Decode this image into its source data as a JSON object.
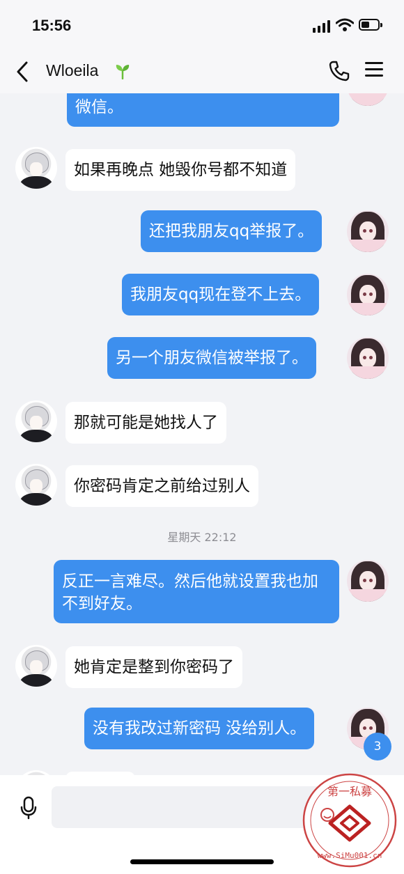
{
  "status_bar": {
    "time": "15:56"
  },
  "header": {
    "contact_name": "Wloeila"
  },
  "messages": [
    {
      "side": "out",
      "text": "微信。"
    },
    {
      "side": "in",
      "text": "如果再晚点 她毁你号都不知道"
    },
    {
      "side": "out",
      "text": "还把我朋友qq举报了。"
    },
    {
      "side": "out",
      "text": "我朋友qq现在登不上去。"
    },
    {
      "side": "out",
      "text": "另一个朋友微信被举报了。"
    },
    {
      "side": "in",
      "text": "那就可能是她找人了"
    },
    {
      "side": "in",
      "text": "你密码肯定之前给过别人"
    },
    {
      "side": "out",
      "text": "反正一言难尽。然后他就设置我也加不到好友。"
    },
    {
      "side": "in",
      "text": "她肯定是整到你密码了"
    },
    {
      "side": "out",
      "text": "没有我改过新密码 没给别人。"
    }
  ],
  "timestamp": "星期天 22:12",
  "unread_badge": "3",
  "watermark": {
    "text_top": "第一私募",
    "url": "www.SiMu001.cn"
  },
  "colors": {
    "outgoing_bubble": "#3d8fee",
    "incoming_bubble": "#ffffff",
    "background": "#f2f3f6"
  }
}
